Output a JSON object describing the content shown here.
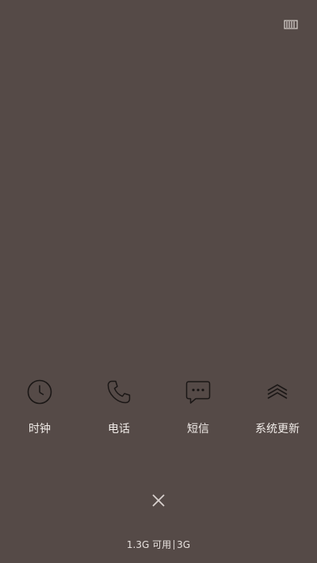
{
  "status_icon": "memory-card-icon",
  "apps": [
    {
      "label": "时钟",
      "icon": "clock-icon"
    },
    {
      "label": "电话",
      "icon": "phone-icon"
    },
    {
      "label": "短信",
      "icon": "message-icon"
    },
    {
      "label": "系统更新",
      "icon": "system-update-icon"
    }
  ],
  "close_icon": "close-icon",
  "memory_status": {
    "available_text": "1.3G 可用",
    "total_text": "3G"
  },
  "colors": {
    "background": "#554a47",
    "icon_stroke": "#1b1716",
    "text": "#f1ece9"
  }
}
